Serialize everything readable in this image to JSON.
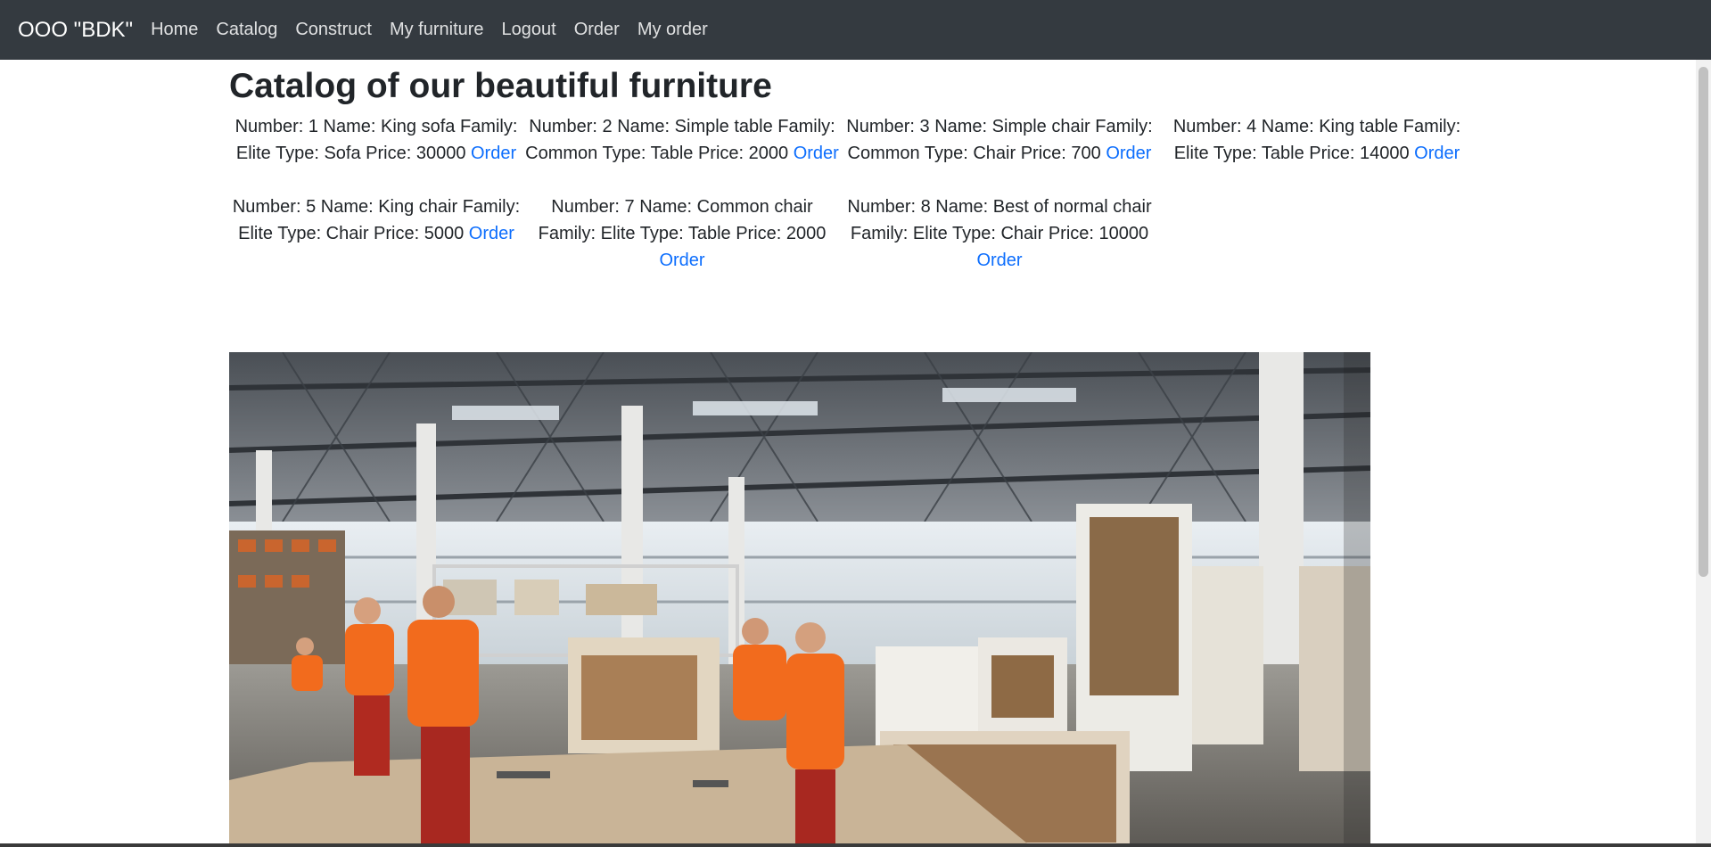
{
  "navbar": {
    "brand": "OOO \"BDK\"",
    "items": [
      "Home",
      "Catalog",
      "Construct",
      "My furniture",
      "Logout",
      "Order",
      "My order"
    ]
  },
  "page": {
    "title": "Catalog of our beautiful furniture"
  },
  "catalog": {
    "order_label": "Order",
    "items": [
      {
        "text": "Number: 1 Name: King sofa Family: Elite Type: Sofa Price: 30000"
      },
      {
        "text": "Number: 2 Name: Simple table Family: Common Type: Table Price: 2000"
      },
      {
        "text": "Number: 3 Name: Simple chair Family: Common Type: Chair Price: 700"
      },
      {
        "text": "Number: 4 Name: King table Family: Elite Type: Table Price: 14000"
      },
      {
        "text": "Number: 5 Name: King chair Family: Elite Type: Chair Price: 5000"
      },
      {
        "text": "Number: 7 Name: Common chair Family: Elite Type: Table Price: 2000"
      },
      {
        "text": "Number: 8 Name: Best of normal chair Family: Elite Type: Chair Price: 10000"
      }
    ]
  },
  "colors": {
    "navbar_bg": "#343a40",
    "link": "#0d6efd",
    "worker_shirt": "#f26b1d"
  },
  "icons": [
    "factory-photo"
  ]
}
